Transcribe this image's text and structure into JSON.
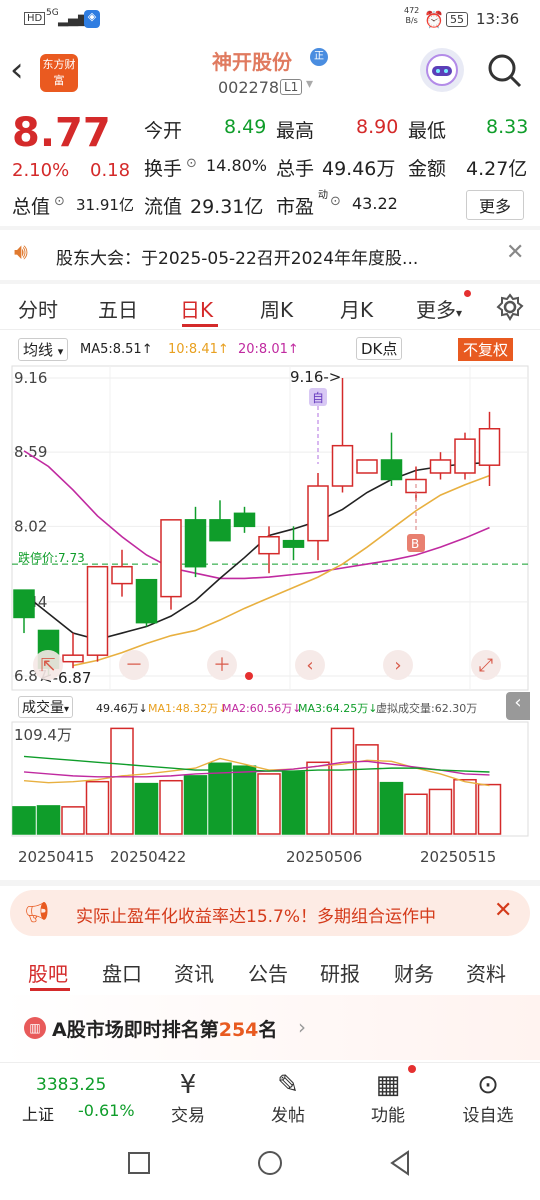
{
  "status": {
    "hd": "HD",
    "net": "5G",
    "speed_value": "472",
    "speed_unit": "B/s",
    "battery": "55",
    "time": "13:36"
  },
  "header": {
    "back_icon": "chevron-left-icon",
    "logo_text": "东方财富",
    "stock_name": "神开股份",
    "badge": "正",
    "stock_code": "002278",
    "level": "L1",
    "search_icon": "search-icon"
  },
  "quote": {
    "price": "8.77",
    "change_pct": "2.10%",
    "change": "0.18",
    "open_label": "今开",
    "open": "8.49",
    "high_label": "最高",
    "high": "8.90",
    "low_label": "最低",
    "low": "8.33",
    "turnover_label": "换手",
    "turnover": "14.80%",
    "volume_label": "总手",
    "volume": "49.46万",
    "amount_label": "金额",
    "amount": "4.27亿",
    "mktcap_label": "总值",
    "mktcap": "31.91亿",
    "float_label": "流值",
    "float": "29.31亿",
    "pe_label": "市盈",
    "pe_sup": "动",
    "pe": "43.22",
    "more_label": "更多"
  },
  "notice": {
    "text": "股东大会：于2025-05-22召开2024年年度股..."
  },
  "tabs": [
    "分时",
    "五日",
    "日K",
    "周K",
    "月K",
    "更多"
  ],
  "active_tab": "日K",
  "chart_controls": {
    "ma_type": "均线",
    "ma5": "MA5:8.51↑",
    "ma10": "10:8.41↑",
    "ma20": "20:8.01↑",
    "dk": "DK点",
    "fq": "不复权",
    "vol_label": "成交量",
    "vol_val": "49.46万↓",
    "vma1": "MA1:48.32万↓",
    "vma2": "MA2:60.56万↓",
    "vma3": "MA3:64.25万↓",
    "virtual": "虚拟成交量:62.30万"
  },
  "chart_data": {
    "type": "candlestick",
    "y_ticks": [
      "9.16",
      "8.59",
      "8.02",
      "7.44",
      "6.87"
    ],
    "ylim": [
      6.87,
      9.16
    ],
    "limit_down_label": "跌停价:7.73",
    "limit_down": 7.73,
    "max_label": "9.16->",
    "min_label": "<-6.87",
    "marker_self": "自",
    "marker_b": "B",
    "candles": [
      {
        "o": 7.53,
        "c": 7.32,
        "h": 7.53,
        "l": 7.2
      },
      {
        "o": 7.22,
        "c": 6.93,
        "h": 7.22,
        "l": 6.87
      },
      {
        "o": 6.98,
        "c": 7.03,
        "h": 7.2,
        "l": 6.93
      },
      {
        "o": 7.03,
        "c": 7.71,
        "h": 7.71,
        "l": 6.98
      },
      {
        "o": 7.58,
        "c": 7.71,
        "h": 7.84,
        "l": 7.48
      },
      {
        "o": 7.61,
        "c": 7.28,
        "h": 7.61,
        "l": 7.25
      },
      {
        "o": 7.48,
        "c": 8.07,
        "h": 8.07,
        "l": 7.38
      },
      {
        "o": 8.07,
        "c": 7.71,
        "h": 8.17,
        "l": 7.63
      },
      {
        "o": 8.07,
        "c": 7.91,
        "h": 8.22,
        "l": 7.91
      },
      {
        "o": 8.12,
        "c": 8.02,
        "h": 8.17,
        "l": 7.97
      },
      {
        "o": 7.81,
        "c": 7.94,
        "h": 8.02,
        "l": 7.66
      },
      {
        "o": 7.91,
        "c": 7.86,
        "h": 8.02,
        "l": 7.76
      },
      {
        "o": 7.91,
        "c": 8.33,
        "h": 8.43,
        "l": 7.76
      },
      {
        "o": 8.33,
        "c": 8.64,
        "h": 9.16,
        "l": 8.28
      },
      {
        "o": 8.43,
        "c": 8.53,
        "h": 8.53,
        "l": 8.43
      },
      {
        "o": 8.53,
        "c": 8.38,
        "h": 8.74,
        "l": 8.33
      },
      {
        "o": 8.28,
        "c": 8.38,
        "h": 8.48,
        "l": 8.22
      },
      {
        "o": 8.43,
        "c": 8.53,
        "h": 8.59,
        "l": 8.38
      },
      {
        "o": 8.43,
        "c": 8.69,
        "h": 8.74,
        "l": 8.38
      },
      {
        "o": 8.49,
        "c": 8.77,
        "h": 8.9,
        "l": 8.33
      }
    ],
    "ma5": [
      7.5,
      7.35,
      7.2,
      7.15,
      7.2,
      7.25,
      7.33,
      7.45,
      7.62,
      7.78,
      7.95,
      8.0,
      8.06,
      8.15,
      8.28,
      8.38,
      8.45,
      8.48,
      8.5,
      8.51
    ],
    "ma10": [
      null,
      null,
      6.95,
      6.99,
      7.05,
      7.12,
      7.18,
      7.22,
      7.3,
      7.39,
      7.47,
      7.55,
      7.63,
      7.73,
      7.86,
      8.0,
      8.14,
      8.26,
      8.34,
      8.41
    ],
    "ma20": [
      8.6,
      8.48,
      8.3,
      8.1,
      7.94,
      7.8,
      7.7,
      7.66,
      7.62,
      7.62,
      7.63,
      7.65,
      7.67,
      7.7,
      7.73,
      7.76,
      7.8,
      7.86,
      7.93,
      8.01
    ],
    "vol_tick": "109.4万",
    "volumes": [
      28,
      29,
      28,
      54,
      109,
      52,
      55,
      60,
      73,
      70,
      62,
      64,
      74,
      109,
      92,
      53,
      41,
      46,
      56,
      51
    ],
    "vol_ma1": [
      55,
      53,
      54,
      56,
      60,
      62,
      65,
      68,
      78,
      72,
      66,
      67,
      70,
      72,
      76,
      75,
      68,
      62,
      54,
      50
    ],
    "vol_ma2": [
      64,
      62,
      60,
      59,
      59,
      59,
      60,
      62,
      63,
      64,
      65,
      67,
      70,
      74,
      75,
      72,
      69,
      66,
      62,
      61
    ],
    "vol_ma3": [
      80,
      78,
      76,
      74,
      72,
      70,
      68,
      66,
      66,
      66,
      65,
      65,
      66,
      66,
      67,
      68,
      68,
      66,
      65,
      64
    ],
    "x_labels": [
      "20250415",
      "20250422",
      "20250506",
      "20250515"
    ]
  },
  "banner": {
    "text": "实际止盈年化收益率达15.7%！多期组合运作中"
  },
  "subtabs": [
    "股吧",
    "盘口",
    "资讯",
    "公告",
    "研报",
    "财务",
    "资料"
  ],
  "active_subtab": "股吧",
  "rank": {
    "prefix": "A股市场即时排名第",
    "num": "254",
    "suffix": "名"
  },
  "bottom": {
    "index_value": "3383.25",
    "index_name": "上证",
    "index_change": "-0.61%",
    "trade": "交易",
    "post": "发帖",
    "func": "功能",
    "watchlist": "设自选"
  }
}
